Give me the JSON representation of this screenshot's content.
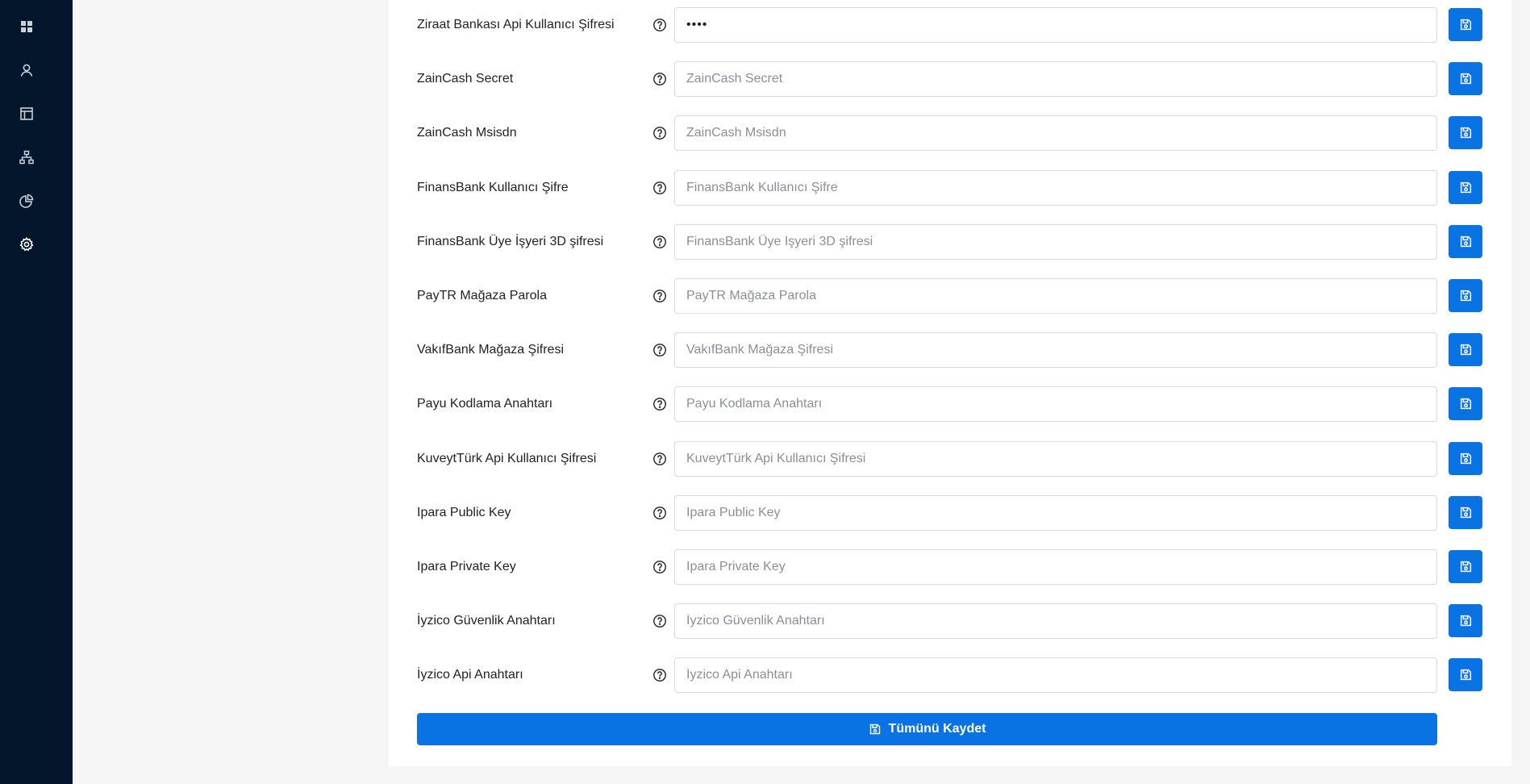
{
  "sidebar": {
    "items": [
      {
        "icon": "dashboard-grid-icon"
      },
      {
        "icon": "user-icon"
      },
      {
        "icon": "layout-icon"
      },
      {
        "icon": "sitemap-icon"
      },
      {
        "icon": "pie-chart-icon"
      },
      {
        "icon": "gear-icon"
      }
    ]
  },
  "settings": {
    "rows": [
      {
        "label": "Ziraat Bankası Api Kullanıcı Şifresi",
        "value": "••••",
        "placeholder": ""
      },
      {
        "label": "ZainCash Secret",
        "value": "",
        "placeholder": "ZainCash Secret"
      },
      {
        "label": "ZainCash Msisdn",
        "value": "",
        "placeholder": "ZainCash Msisdn"
      },
      {
        "label": "FinansBank Kullanıcı Şifre",
        "value": "",
        "placeholder": "FinansBank Kullanıcı Şifre"
      },
      {
        "label": "FinansBank Üye İşyeri 3D şifresi",
        "value": "",
        "placeholder": "FinansBank Üye İşyeri 3D şifresi"
      },
      {
        "label": "PayTR Mağaza Parola",
        "value": "",
        "placeholder": "PayTR Mağaza Parola"
      },
      {
        "label": "VakıfBank Mağaza Şifresi",
        "value": "",
        "placeholder": "VakıfBank Mağaza Şifresi"
      },
      {
        "label": "Payu Kodlama Anahtarı",
        "value": "",
        "placeholder": "Payu Kodlama Anahtarı"
      },
      {
        "label": "KuveytTürk Api Kullanıcı Şifresi",
        "value": "",
        "placeholder": "KuveytTürk Api Kullanıcı Şifresi"
      },
      {
        "label": "Ipara Public Key",
        "value": "",
        "placeholder": "Ipara Public Key"
      },
      {
        "label": "Ipara Private Key",
        "value": "",
        "placeholder": "Ipara Private Key"
      },
      {
        "label": "İyzico Güvenlik Anahtarı",
        "value": "",
        "placeholder": "İyzico Güvenlik Anahtarı"
      },
      {
        "label": "İyzico Api Anahtarı",
        "value": "",
        "placeholder": "İyzico Api Anahtarı"
      }
    ],
    "save_all_label": "Tümünü Kaydet"
  },
  "colors": {
    "sidebar_bg": "#04162b",
    "accent": "#0a73e3",
    "page_bg": "#f5f5f5",
    "panel_bg": "#ffffff"
  }
}
